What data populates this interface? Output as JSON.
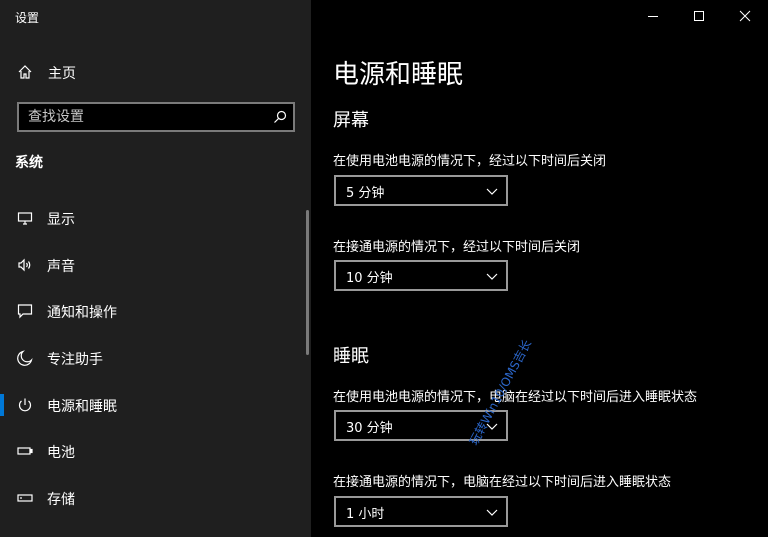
{
  "window": {
    "title": "设置"
  },
  "sidebar": {
    "home_label": "主页",
    "search_placeholder": "查找设置",
    "section_label": "系统",
    "items": [
      {
        "label": "显示",
        "icon": "monitor-icon"
      },
      {
        "label": "声音",
        "icon": "speaker-icon"
      },
      {
        "label": "通知和操作",
        "icon": "notification-icon"
      },
      {
        "label": "专注助手",
        "icon": "moon-icon"
      },
      {
        "label": "电源和睡眠",
        "icon": "power-icon",
        "active": true
      },
      {
        "label": "电池",
        "icon": "battery-icon"
      },
      {
        "label": "存储",
        "icon": "storage-icon"
      }
    ]
  },
  "main": {
    "title": "电源和睡眠",
    "screen": {
      "title": "屏幕",
      "battery_label": "在使用电池电源的情况下，经过以下时间后关闭",
      "battery_value": "5 分钟",
      "plugged_label": "在接通电源的情况下，经过以下时间后关闭",
      "plugged_value": "10 分钟"
    },
    "sleep": {
      "title": "睡眠",
      "battery_label": "在使用电池电源的情况下，电脑在经过以下时间后进入睡眠状态",
      "battery_value": "30 分钟",
      "plugged_label": "在接通电源的情况下，电脑在经过以下时间后进入睡眠状态",
      "plugged_value": "1 小时"
    }
  },
  "watermark": "玩转Win10/OMS吉长",
  "colors": {
    "accent": "#0078d7",
    "sidebar_bg": "#1f1f1f",
    "content_bg": "#000000"
  }
}
